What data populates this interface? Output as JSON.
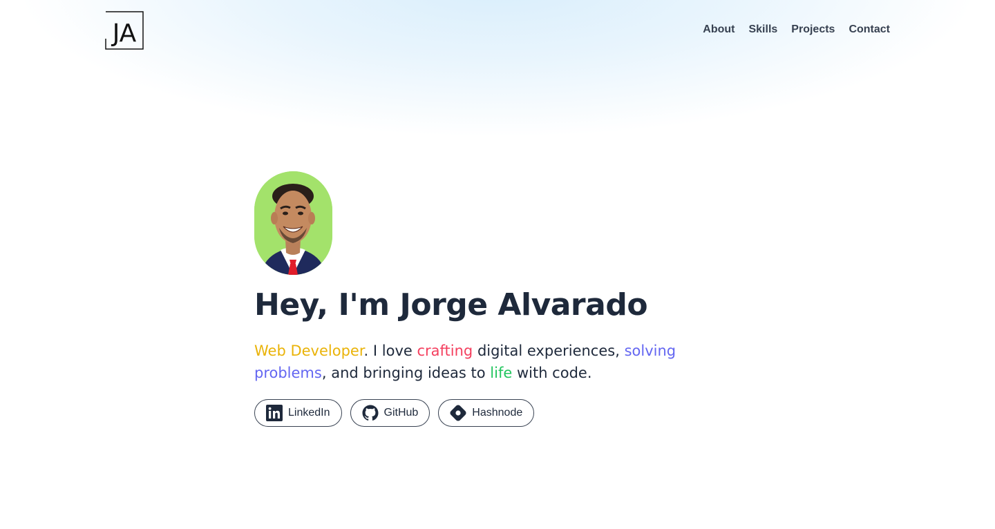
{
  "header": {
    "logo_text": "JA",
    "nav": [
      {
        "label": "About"
      },
      {
        "label": "Skills"
      },
      {
        "label": "Projects"
      },
      {
        "label": "Contact"
      }
    ]
  },
  "hero": {
    "title": "Hey, I'm Jorge Alvarado",
    "tagline": {
      "part1": "Web Developer",
      "part2": ". I love ",
      "part3": "crafting",
      "part4": " digital experiences, ",
      "part5": "solving problems",
      "part6": ", and bringing ideas to ",
      "part7": "life",
      "part8": " with code."
    },
    "socials": [
      {
        "label": "LinkedIn",
        "icon": "linkedin-icon"
      },
      {
        "label": "GitHub",
        "icon": "github-icon"
      },
      {
        "label": "Hashnode",
        "icon": "hashnode-icon"
      }
    ]
  },
  "colors": {
    "accent_yellow": "#eab308",
    "accent_red": "#f43f5e",
    "accent_blue": "#6366f1",
    "accent_green": "#22c55e",
    "text": "#1e293b",
    "avatar_bg": "#a3e26b"
  }
}
